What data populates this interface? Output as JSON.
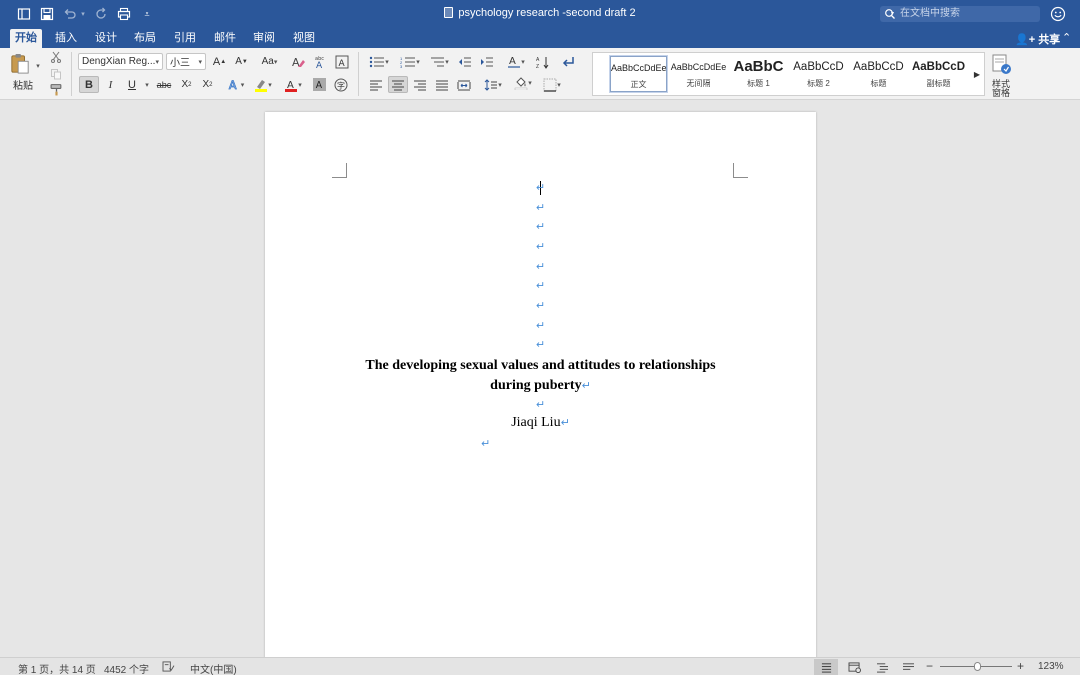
{
  "app": {
    "title": "psychology research -second draft 2",
    "search_placeholder": "在文档中搜索",
    "share_label": "共享"
  },
  "tabs": [
    "开始",
    "插入",
    "设计",
    "布局",
    "引用",
    "邮件",
    "审阅",
    "视图"
  ],
  "ribbon": {
    "paste_label": "粘贴",
    "font_name": "DengXian Reg...",
    "font_size": "小三",
    "styles": [
      {
        "sample": "AaBbCcDdEe",
        "name": "正文"
      },
      {
        "sample": "AaBbCcDdEe",
        "name": "无间隔"
      },
      {
        "sample": "AaBbC",
        "name": "标题 1"
      },
      {
        "sample": "AaBbCcD",
        "name": "标题 2"
      },
      {
        "sample": "AaBbCcD",
        "name": "标题"
      },
      {
        "sample": "AaBbCcD",
        "name": "副标题"
      }
    ],
    "styles_pane_label_1": "样式",
    "styles_pane_label_2": "窗格"
  },
  "document": {
    "title_line1": "The developing sexual values and attitudes to relationships",
    "title_line2": "during puberty",
    "author": "Jiaqi Liu",
    "paragraph_mark": "↵"
  },
  "statusbar": {
    "page_info": "第 1 页，共 14 页",
    "word_count": "4452 个字",
    "language": "中文(中国)",
    "zoom": "123%"
  },
  "colors": {
    "accent": "#2b579a",
    "paragraph_mark": "#4a90d9",
    "highlight": "#ffff00",
    "font_color": "#e02020"
  }
}
